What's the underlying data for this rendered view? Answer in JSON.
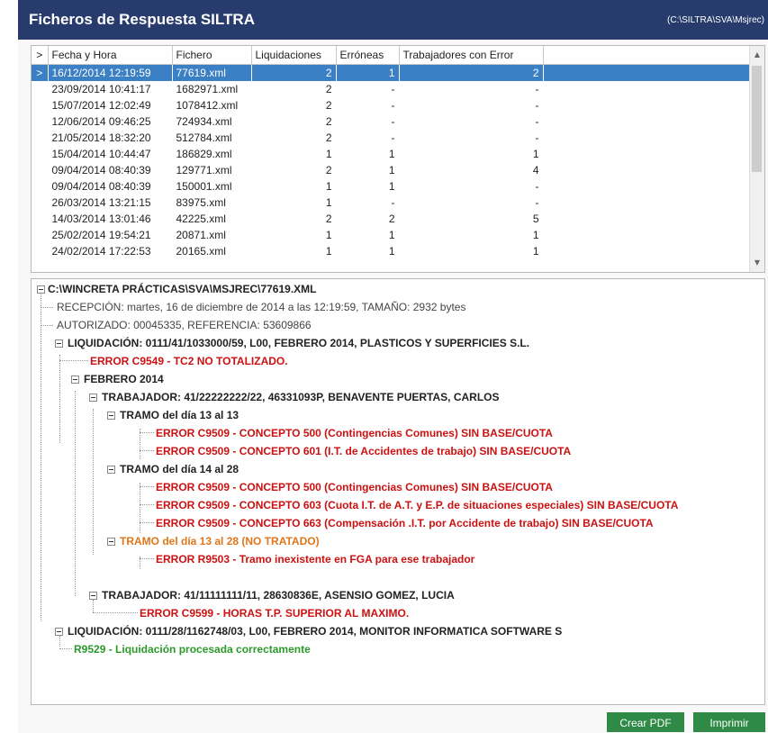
{
  "window": {
    "title": "Ficheros de Respuesta SILTRA",
    "path": "(C:\\SILTRA\\SVA\\Msjrec)"
  },
  "grid": {
    "headers": [
      "Fecha y Hora",
      "Fichero",
      "Liquidaciones",
      "Erróneas",
      "Trabajadores con Error"
    ],
    "indicator_header": ">",
    "selected_indicator": ">",
    "rows": [
      {
        "fecha": "16/12/2014 12:19:59",
        "fichero": "77619.xml",
        "liq": "2",
        "err": "1",
        "trab": "2"
      },
      {
        "fecha": "23/09/2014 10:41:17",
        "fichero": "1682971.xml",
        "liq": "2",
        "err": "-",
        "trab": "-"
      },
      {
        "fecha": "15/07/2014 12:02:49",
        "fichero": "1078412.xml",
        "liq": "2",
        "err": "-",
        "trab": "-"
      },
      {
        "fecha": "12/06/2014 09:46:25",
        "fichero": "724934.xml",
        "liq": "2",
        "err": "-",
        "trab": "-"
      },
      {
        "fecha": "21/05/2014 18:32:20",
        "fichero": "512784.xml",
        "liq": "2",
        "err": "-",
        "trab": "-"
      },
      {
        "fecha": "15/04/2014 10:44:47",
        "fichero": "186829.xml",
        "liq": "1",
        "err": "1",
        "trab": "1"
      },
      {
        "fecha": "09/04/2014 08:40:39",
        "fichero": "129771.xml",
        "liq": "2",
        "err": "1",
        "trab": "4"
      },
      {
        "fecha": "09/04/2014 08:40:39",
        "fichero": "150001.xml",
        "liq": "1",
        "err": "1",
        "trab": "-"
      },
      {
        "fecha": "26/03/2014 13:21:15",
        "fichero": "83975.xml",
        "liq": "1",
        "err": "-",
        "trab": "-"
      },
      {
        "fecha": "14/03/2014 13:01:46",
        "fichero": "42225.xml",
        "liq": "2",
        "err": "2",
        "trab": "5"
      },
      {
        "fecha": "25/02/2014 19:54:21",
        "fichero": "20871.xml",
        "liq": "1",
        "err": "1",
        "trab": "1"
      },
      {
        "fecha": "24/02/2014 17:22:53",
        "fichero": "20165.xml",
        "liq": "1",
        "err": "1",
        "trab": "1"
      }
    ]
  },
  "tree": {
    "root": "C:\\WINCRETA PRÁCTICAS\\SVA\\MSJREC\\77619.XML",
    "recepcion": "RECEPCIÓN: martes, 16 de diciembre de 2014 a las 12:19:59, TAMAÑO: 2932 bytes",
    "autorizado": "AUTORIZADO: 00045335,  REFERENCIA: 53609866",
    "liq1": "LIQUIDACIÓN: 0111/41/1033000/59, L00, FEBRERO 2014, PLASTICOS Y SUPERFICIES S.L.",
    "err_c9549": "ERROR C9549 - TC2 NO TOTALIZADO.",
    "febrero": "FEBRERO 2014",
    "trab1": "TRABAJADOR: 41/22222222/22, 46331093P, BENAVENTE PUERTAS, CARLOS",
    "tramo1": "TRAMO del día 13 al 13",
    "t1e1": "ERROR C9509 - CONCEPTO 500 (Contingencias Comunes) SIN BASE/CUOTA",
    "t1e2": "ERROR C9509 - CONCEPTO 601 (I.T. de Accidentes de trabajo) SIN BASE/CUOTA",
    "tramo2": "TRAMO del día 14 al 28",
    "t2e1": "ERROR C9509 - CONCEPTO 500 (Contingencias Comunes) SIN BASE/CUOTA",
    "t2e2": "ERROR C9509 - CONCEPTO 603 (Cuota I.T. de A.T. y E.P. de situaciones especiales) SIN BASE/CUOTA",
    "t2e3": "ERROR C9509 - CONCEPTO 663 (Compensación .I.T. por Accidente de trabajo) SIN BASE/CUOTA",
    "tramo3": "TRAMO del día 13 al 28 (NO TRATADO)",
    "t3e1": "ERROR R9503 - Tramo inexistente en FGA para ese trabajador",
    "trab2": "TRABAJADOR: 41/11111111/11, 28630836E, ASENSIO GOMEZ, LUCIA",
    "trab2e1": "ERROR C9599 - HORAS T.P. SUPERIOR AL MAXIMO.",
    "liq2": "LIQUIDACIÓN: 0111/28/1162748/03, L00, FEBRERO 2014, MONITOR INFORMATICA SOFTWARE S",
    "ok": "R9529 - Liquidación procesada correctamente"
  },
  "buttons": {
    "pdf": "Crear PDF",
    "print": "Imprimir"
  },
  "colors": {
    "titlebar": "#273c6d",
    "selection": "#3b7fc4",
    "error": "#cc1111",
    "warning": "#e0761a",
    "success": "#2b9a2b",
    "button": "#2e8a46"
  }
}
